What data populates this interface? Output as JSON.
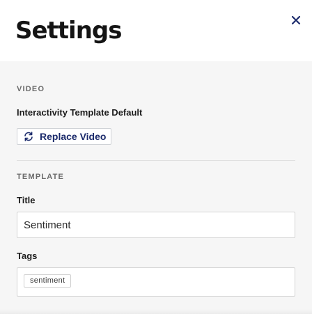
{
  "header": {
    "title": "Settings",
    "close_icon": "close-icon",
    "accent_color": "#1b2a6b"
  },
  "video_section": {
    "heading": "VIDEO",
    "field_label": "Interactivity Template Default",
    "replace_button": {
      "label": "Replace Video",
      "icon": "refresh-icon"
    }
  },
  "template_section": {
    "heading": "TEMPLATE",
    "title_field": {
      "label": "Title",
      "value": "Sentiment"
    },
    "tags_field": {
      "label": "Tags",
      "tags": [
        "sentiment"
      ]
    }
  }
}
